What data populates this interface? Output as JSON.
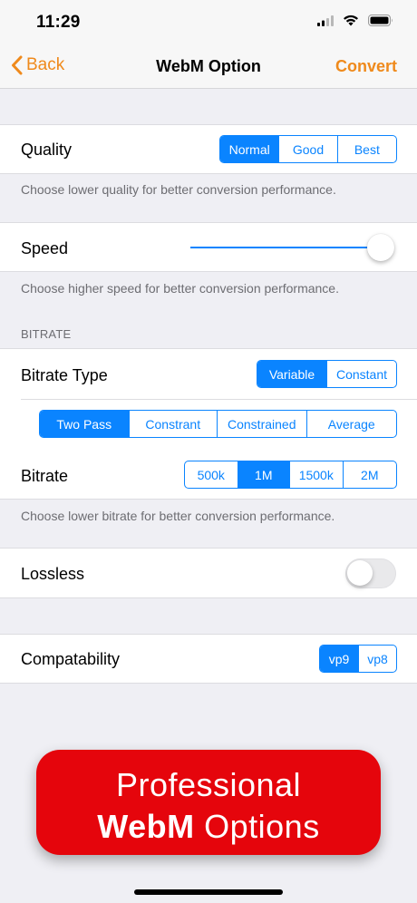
{
  "status_bar": {
    "time": "11:29"
  },
  "nav": {
    "back_label": "Back",
    "title": "WebM Option",
    "action_label": "Convert"
  },
  "quality": {
    "label": "Quality",
    "options": [
      "Normal",
      "Good",
      "Best"
    ],
    "selected": "Normal",
    "footer": "Choose lower quality for better conversion performance."
  },
  "speed": {
    "label": "Speed",
    "value_fraction": 1.0,
    "footer": "Choose higher speed for better conversion performance."
  },
  "bitrate_section": {
    "header": "BITRATE",
    "type_label": "Bitrate Type",
    "type_options": [
      "Variable",
      "Constant"
    ],
    "type_selected": "Variable",
    "mode_options": [
      "Two Pass",
      "Constrant",
      "Constrained",
      "Average"
    ],
    "mode_selected": "Two Pass",
    "bitrate_label": "Bitrate",
    "bitrate_options": [
      "500k",
      "1M",
      "1500k",
      "2M"
    ],
    "bitrate_selected": "1M",
    "footer": "Choose lower bitrate for better conversion performance."
  },
  "lossless": {
    "label": "Lossless",
    "on": false
  },
  "compatability": {
    "label": "Compatability",
    "options": [
      "vp9",
      "vp8"
    ],
    "selected": "vp9"
  },
  "promo": {
    "line1": "Professional",
    "line2_bold": "WebM",
    "line2_rest": " Options"
  },
  "colors": {
    "accent": "#0a84ff",
    "nav_accent": "#ef8a1c",
    "promo_bg": "#e5050c"
  }
}
